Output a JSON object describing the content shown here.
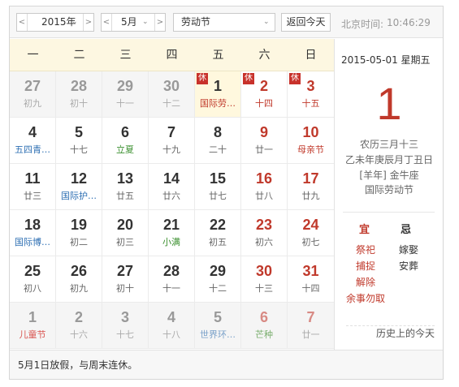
{
  "header": {
    "year": "2015年",
    "month": "5月",
    "holiday": "劳动节",
    "today_button": "返回今天",
    "time_label": "北京时间:",
    "time_value": "10:46:29"
  },
  "weekdays": [
    "一",
    "二",
    "三",
    "四",
    "五",
    "六",
    "日"
  ],
  "weeks": [
    [
      {
        "day": "27",
        "sub": "初九",
        "other": true
      },
      {
        "day": "28",
        "sub": "初十",
        "other": true
      },
      {
        "day": "29",
        "sub": "十一",
        "other": true
      },
      {
        "day": "30",
        "sub": "十二",
        "other": true
      },
      {
        "day": "1",
        "sub": "国际劳…",
        "subtype": "fest",
        "rest": "休",
        "today": true
      },
      {
        "day": "2",
        "sub": "十四",
        "subtype": "fest",
        "rest": "休",
        "weekend": true
      },
      {
        "day": "3",
        "sub": "十五",
        "subtype": "fest",
        "rest": "休",
        "weekend": true
      }
    ],
    [
      {
        "day": "4",
        "sub": "五四青…",
        "subtype": "intl"
      },
      {
        "day": "5",
        "sub": "十七"
      },
      {
        "day": "6",
        "sub": "立夏",
        "subtype": "term"
      },
      {
        "day": "7",
        "sub": "十九"
      },
      {
        "day": "8",
        "sub": "二十"
      },
      {
        "day": "9",
        "sub": "廿一",
        "weekend": true
      },
      {
        "day": "10",
        "sub": "母亲节",
        "subtype": "fest",
        "weekend": true
      }
    ],
    [
      {
        "day": "11",
        "sub": "廿三"
      },
      {
        "day": "12",
        "sub": "国际护…",
        "subtype": "intl"
      },
      {
        "day": "13",
        "sub": "廿五"
      },
      {
        "day": "14",
        "sub": "廿六"
      },
      {
        "day": "15",
        "sub": "廿七"
      },
      {
        "day": "16",
        "sub": "廿八",
        "weekend": true
      },
      {
        "day": "17",
        "sub": "廿九",
        "weekend": true
      }
    ],
    [
      {
        "day": "18",
        "sub": "国际博…",
        "subtype": "intl"
      },
      {
        "day": "19",
        "sub": "初二"
      },
      {
        "day": "20",
        "sub": "初三"
      },
      {
        "day": "21",
        "sub": "小满",
        "subtype": "term"
      },
      {
        "day": "22",
        "sub": "初五"
      },
      {
        "day": "23",
        "sub": "初六",
        "weekend": true
      },
      {
        "day": "24",
        "sub": "初七",
        "weekend": true
      }
    ],
    [
      {
        "day": "25",
        "sub": "初八"
      },
      {
        "day": "26",
        "sub": "初九"
      },
      {
        "day": "27",
        "sub": "初十"
      },
      {
        "day": "28",
        "sub": "十一"
      },
      {
        "day": "29",
        "sub": "十二"
      },
      {
        "day": "30",
        "sub": "十三",
        "weekend": true
      },
      {
        "day": "31",
        "sub": "十四",
        "weekend": true
      }
    ],
    [
      {
        "day": "1",
        "sub": "儿童节",
        "subtype": "fest",
        "other": true
      },
      {
        "day": "2",
        "sub": "十六",
        "other": true
      },
      {
        "day": "3",
        "sub": "十七",
        "other": true
      },
      {
        "day": "4",
        "sub": "十八",
        "other": true
      },
      {
        "day": "5",
        "sub": "世界环…",
        "subtype": "intl",
        "other": true
      },
      {
        "day": "6",
        "sub": "芒种",
        "subtype": "term",
        "other": true,
        "weekend": true
      },
      {
        "day": "7",
        "sub": "廿一",
        "other": true,
        "weekend": true
      }
    ]
  ],
  "side": {
    "date": "2015-05-01  星期五",
    "day": "1",
    "lunar": "农历三月十三",
    "ganzhi": "乙未年庚辰月丁丑日",
    "zodiac": "[羊年] 金牛座",
    "festival": "国际劳动节",
    "yi_label": "宜",
    "ji_label": "忌",
    "yi": [
      "祭祀",
      "捕捉",
      "解除",
      "余事勿取"
    ],
    "ji": [
      "嫁娶",
      "安葬"
    ],
    "history": "历史上的今天"
  },
  "footer": {
    "note": "5月1日放假，与周末连休。"
  },
  "colors": {
    "accent_red": "#c0392b",
    "header_bg": "#fdf7e1",
    "term_green": "#3a8f2e",
    "intl_blue": "#2e6fb3"
  }
}
